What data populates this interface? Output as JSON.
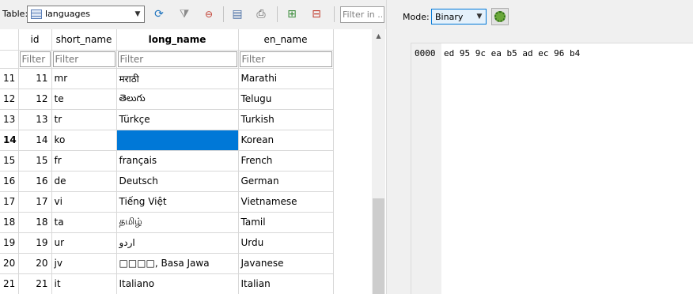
{
  "toolbar": {
    "table_label": "Table:",
    "table_value": "languages",
    "filter_placeholder": "Filter in ...",
    "icons": [
      "refresh-icon",
      "clear-filters-icon",
      "delete-filter-icon",
      "save-table-icon",
      "print-icon",
      "insert-record-icon",
      "delete-record-icon"
    ]
  },
  "grid": {
    "columns": [
      "id",
      "short_name",
      "long_name",
      "en_name"
    ],
    "filter_placeholder": "Filter",
    "rows": [
      {
        "rownum": "11",
        "id": "11",
        "short_name": "mr",
        "long_name": "मराठी",
        "en_name": "Marathi"
      },
      {
        "rownum": "12",
        "id": "12",
        "short_name": "te",
        "long_name": "తెలుగు",
        "en_name": "Telugu"
      },
      {
        "rownum": "13",
        "id": "13",
        "short_name": "tr",
        "long_name": "Türkçe",
        "en_name": "Turkish"
      },
      {
        "rownum": "14",
        "id": "14",
        "short_name": "ko",
        "long_name": "",
        "en_name": "Korean"
      },
      {
        "rownum": "15",
        "id": "15",
        "short_name": "fr",
        "long_name": "français",
        "en_name": "French"
      },
      {
        "rownum": "16",
        "id": "16",
        "short_name": "de",
        "long_name": "Deutsch",
        "en_name": "German"
      },
      {
        "rownum": "17",
        "id": "17",
        "short_name": "vi",
        "long_name": "Tiếng Việt",
        "en_name": "Vietnamese"
      },
      {
        "rownum": "18",
        "id": "18",
        "short_name": "ta",
        "long_name": "தமிழ்",
        "en_name": "Tamil"
      },
      {
        "rownum": "19",
        "id": "19",
        "short_name": "ur",
        "long_name": "اردو",
        "en_name": "Urdu"
      },
      {
        "rownum": "20",
        "id": "20",
        "short_name": "jv",
        "long_name": "□□□□, Basa Jawa",
        "en_name": "Javanese"
      },
      {
        "rownum": "21",
        "id": "21",
        "short_name": "it",
        "long_name": "Italiano",
        "en_name": "Italian"
      }
    ],
    "current_row": "14",
    "selected_color": "#0078d7"
  },
  "editor": {
    "mode_label": "Mode:",
    "mode_value": "Binary",
    "hex_offset": "0000",
    "hex_bytes": "ed 95 9c ea b5 ad ec 96 b4"
  }
}
